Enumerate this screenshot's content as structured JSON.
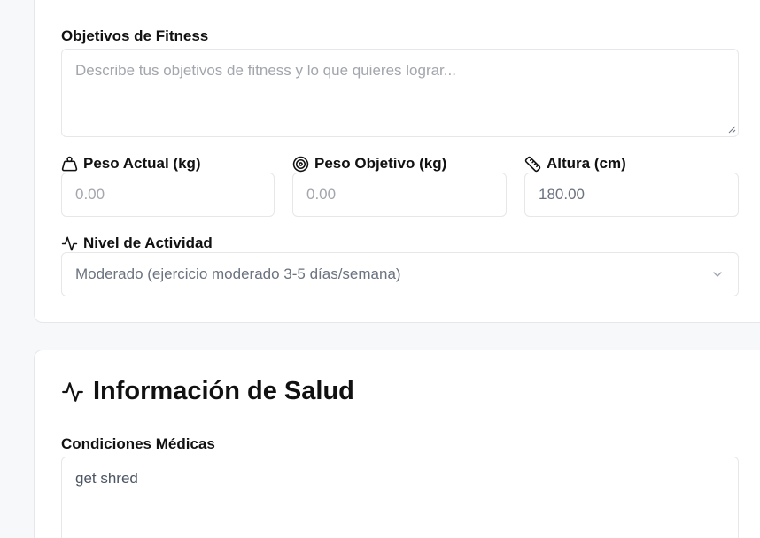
{
  "fitness": {
    "goals_label": "Objetivos de Fitness",
    "goals_placeholder": "Describe tus objetivos de fitness y lo que quieres lograr...",
    "current_weight_label": "Peso Actual (kg)",
    "current_weight_placeholder": "0.00",
    "target_weight_label": "Peso Objetivo (kg)",
    "target_weight_placeholder": "0.00",
    "height_label": "Altura (cm)",
    "height_value": "180.00",
    "activity_label": "Nivel de Actividad",
    "activity_value": "Moderado (ejercicio moderado 3-5 días/semana)"
  },
  "health": {
    "title": "Información de Salud",
    "conditions_label": "Condiciones Médicas",
    "conditions_value": "get shred"
  },
  "icons": {
    "weight": "weight-icon",
    "target": "target-icon",
    "ruler": "ruler-icon",
    "activity": "activity-icon",
    "chevron": "chevron-down-icon"
  }
}
